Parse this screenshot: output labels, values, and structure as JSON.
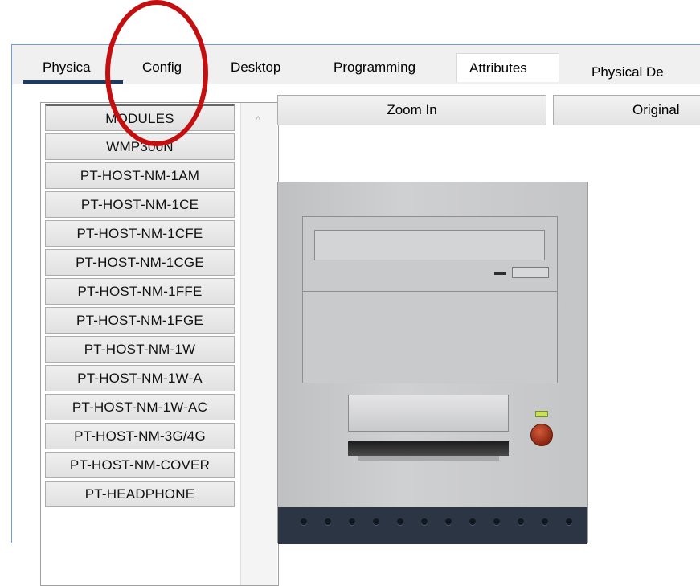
{
  "tabs": [
    {
      "label": "Physica"
    },
    {
      "label": "Config"
    },
    {
      "label": "Desktop"
    },
    {
      "label": "Programming"
    },
    {
      "label": "Attributes"
    }
  ],
  "modules": {
    "header": "MODULES",
    "items": [
      "WMP300N",
      "PT-HOST-NM-1AM",
      "PT-HOST-NM-1CE",
      "PT-HOST-NM-1CFE",
      "PT-HOST-NM-1CGE",
      "PT-HOST-NM-1FFE",
      "PT-HOST-NM-1FGE",
      "PT-HOST-NM-1W",
      "PT-HOST-NM-1W-A",
      "PT-HOST-NM-1W-AC",
      "PT-HOST-NM-3G/4G",
      "PT-HOST-NM-COVER",
      "PT-HEADPHONE"
    ]
  },
  "physical_view": {
    "label": "Physical De",
    "zoom_in": "Zoom In",
    "original": "Original"
  },
  "colors": {
    "annotation": "#c40f10",
    "tab_underline": "#1c3b63",
    "window_border": "#6e9fd6"
  }
}
